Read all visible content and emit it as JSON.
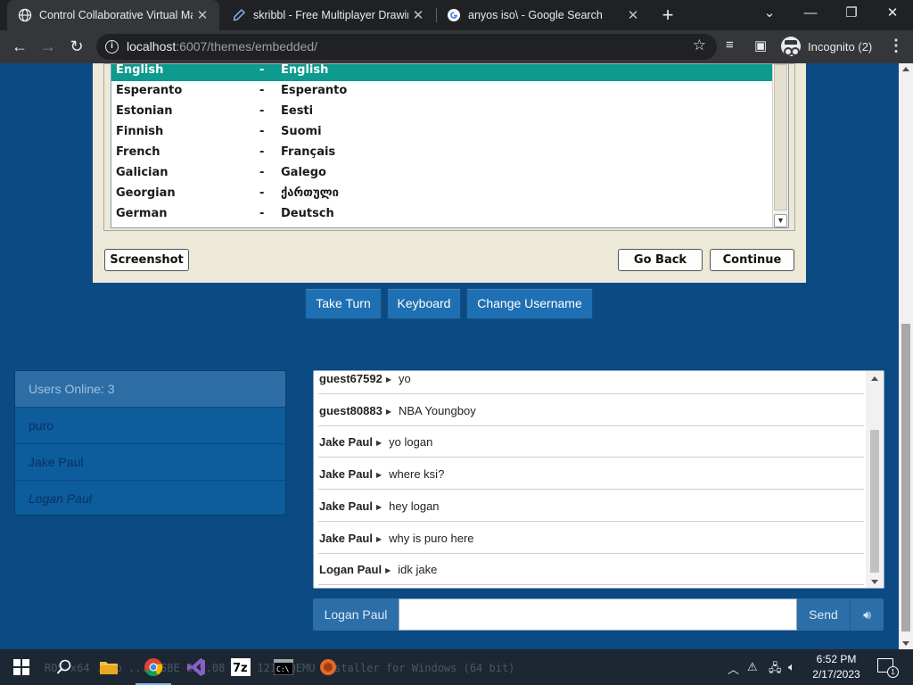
{
  "browser": {
    "tabs": [
      {
        "title": "Control Collaborative Virtual Machines",
        "active": true
      },
      {
        "title": "skribbl - Free Multiplayer Drawing & Guessing Game",
        "active": false
      },
      {
        "title": "anyos iso\\ - Google Search",
        "active": false
      }
    ],
    "url_host": "localhost",
    "url_path": ":6007/themes/embedded/",
    "profile_label": "Incognito (2)"
  },
  "installer": {
    "languages": [
      {
        "english": "English",
        "native": "English",
        "selected": true
      },
      {
        "english": "Esperanto",
        "native": "Esperanto",
        "selected": false
      },
      {
        "english": "Estonian",
        "native": "Eesti",
        "selected": false
      },
      {
        "english": "Finnish",
        "native": "Suomi",
        "selected": false
      },
      {
        "english": "French",
        "native": "Français",
        "selected": false
      },
      {
        "english": "Galician",
        "native": "Galego",
        "selected": false
      },
      {
        "english": "Georgian",
        "native": "ქართული",
        "selected": false
      },
      {
        "english": "German",
        "native": "Deutsch",
        "selected": false
      }
    ],
    "separator": "-",
    "screenshot_label": "Screenshot",
    "go_back_label": "Go Back",
    "continue_label": "Continue"
  },
  "controls": {
    "take_turn": "Take Turn",
    "keyboard": "Keyboard",
    "change_username": "Change Username"
  },
  "users": {
    "header": "Users Online: 3",
    "list": [
      "puro",
      "Jake Paul",
      "Logan Paul"
    ],
    "current_user": "Logan Paul"
  },
  "chat": {
    "messages": [
      {
        "user": "guest67592",
        "text": "yo"
      },
      {
        "user": "guest80883",
        "text": "NBA Youngboy"
      },
      {
        "user": "Jake Paul",
        "text": "yo logan"
      },
      {
        "user": "Jake Paul",
        "text": "where ksi?"
      },
      {
        "user": "Jake Paul",
        "text": "hey logan"
      },
      {
        "user": "Jake Paul",
        "text": "why is puro here"
      },
      {
        "user": "Logan Paul",
        "text": "idk jake"
      }
    ],
    "username_label": "Logan Paul",
    "input_value": "",
    "send_label": "Send"
  },
  "taskbar": {
    "ghost_text": "ROS-x64  .zip  ...ROSBE  819.08  ...  121M   QEMU Installer for Windows (64 bit)",
    "time": "6:52 PM",
    "date": "2/17/2023",
    "notification_count": "1"
  },
  "colors": {
    "page_bg": "#0b4a82",
    "selection": "#0c9b8e",
    "button_blue": "#1f6fb3"
  }
}
